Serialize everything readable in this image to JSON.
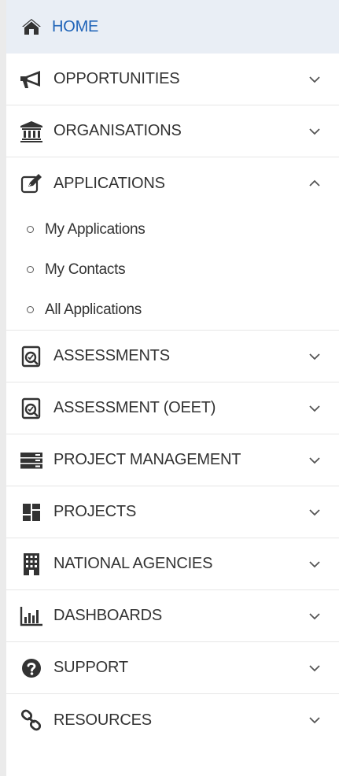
{
  "menu": {
    "home": "HOME",
    "opportunities": "OPPORTUNITIES",
    "organisations": "ORGANISATIONS",
    "applications": "APPLICATIONS",
    "applications_sub": [
      "My Applications",
      "My Contacts",
      "All Applications"
    ],
    "assessments": "ASSESSMENTS",
    "assessment_oeet": "ASSESSMENT (OEET)",
    "project_management": "PROJECT MANAGEMENT",
    "projects": "PROJECTS",
    "national_agencies": "NATIONAL AGENCIES",
    "dashboards": "DASHBOARDS",
    "support": "SUPPORT",
    "resources": "RESOURCES"
  },
  "icons": {
    "home": "home-icon",
    "opportunities": "megaphone-icon",
    "organisations": "bank-icon",
    "applications": "edit-icon",
    "assessments": "document-search-icon",
    "assessment_oeet": "document-search-icon",
    "project_management": "server-icon",
    "projects": "dashboard-tiles-icon",
    "national_agencies": "building-icon",
    "dashboards": "bar-chart-icon",
    "support": "question-circle-icon",
    "resources": "link-icon"
  },
  "colors": {
    "active_background": "#e9eef5",
    "active_text": "#1e63b8",
    "text": "#333333"
  }
}
